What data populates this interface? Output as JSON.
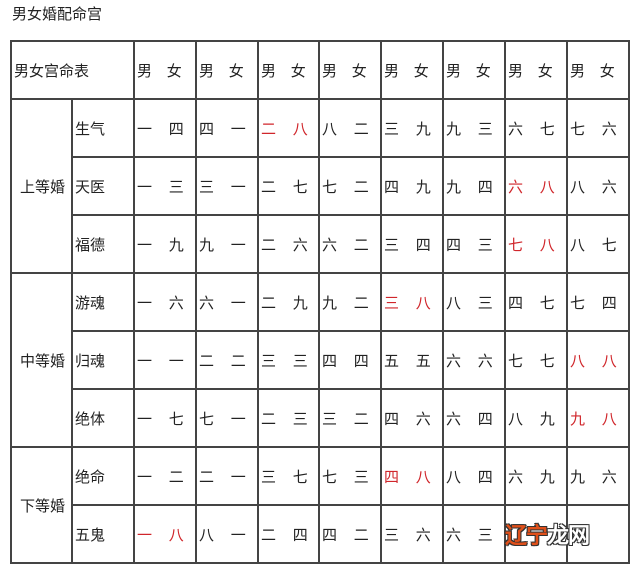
{
  "page": {
    "title": "男女婚配命宫"
  },
  "table": {
    "corner_label": "男女宫命表",
    "column_headers": [
      "男 女",
      "男 女",
      "男 女",
      "男 女",
      "男 女",
      "男 女",
      "男 女",
      "男 女"
    ],
    "highlight_color": "#d0262b",
    "groups": [
      {
        "label": "上等婚",
        "rows": [
          {
            "name": "生气",
            "cells": [
              {
                "text": "一 四",
                "red": false
              },
              {
                "text": "四 一",
                "red": false
              },
              {
                "text": "二 八",
                "red": true
              },
              {
                "text": "八 二",
                "red": false
              },
              {
                "text": "三 九",
                "red": false
              },
              {
                "text": "九 三",
                "red": false
              },
              {
                "text": "六 七",
                "red": false
              },
              {
                "text": "七 六",
                "red": false
              }
            ]
          },
          {
            "name": "天医",
            "cells": [
              {
                "text": "一 三",
                "red": false
              },
              {
                "text": "三 一",
                "red": false
              },
              {
                "text": "二 七",
                "red": false
              },
              {
                "text": "七 二",
                "red": false
              },
              {
                "text": "四 九",
                "red": false
              },
              {
                "text": "九 四",
                "red": false
              },
              {
                "text": "六 八",
                "red": true
              },
              {
                "text": "八 六",
                "red": false
              }
            ]
          },
          {
            "name": "福德",
            "cells": [
              {
                "text": "一 九",
                "red": false
              },
              {
                "text": "九 一",
                "red": false
              },
              {
                "text": "二 六",
                "red": false
              },
              {
                "text": "六 二",
                "red": false
              },
              {
                "text": "三 四",
                "red": false
              },
              {
                "text": "四 三",
                "red": false
              },
              {
                "text": "七 八",
                "red": true
              },
              {
                "text": "八 七",
                "red": false
              }
            ]
          }
        ]
      },
      {
        "label": "中等婚",
        "rows": [
          {
            "name": "游魂",
            "cells": [
              {
                "text": "一 六",
                "red": false
              },
              {
                "text": "六 一",
                "red": false
              },
              {
                "text": "二 九",
                "red": false
              },
              {
                "text": "九 二",
                "red": false
              },
              {
                "text": "三 八",
                "red": true
              },
              {
                "text": "八 三",
                "red": false
              },
              {
                "text": "四 七",
                "red": false
              },
              {
                "text": "七 四",
                "red": false
              }
            ]
          },
          {
            "name": "归魂",
            "cells": [
              {
                "text": "一 一",
                "red": false
              },
              {
                "text": "二 二",
                "red": false
              },
              {
                "text": "三 三",
                "red": false
              },
              {
                "text": "四 四",
                "red": false
              },
              {
                "text": "五 五",
                "red": false
              },
              {
                "text": "六 六",
                "red": false
              },
              {
                "text": "七 七",
                "red": false
              },
              {
                "text": "八 八",
                "red": true
              }
            ]
          },
          {
            "name": "绝体",
            "cells": [
              {
                "text": "一 七",
                "red": false
              },
              {
                "text": "七 一",
                "red": false
              },
              {
                "text": "二 三",
                "red": false
              },
              {
                "text": "三 二",
                "red": false
              },
              {
                "text": "四 六",
                "red": false
              },
              {
                "text": "六 四",
                "red": false
              },
              {
                "text": "八 九",
                "red": false
              },
              {
                "text": "九 八",
                "red": true
              }
            ]
          }
        ]
      },
      {
        "label": "下等婚",
        "rows": [
          {
            "name": "绝命",
            "cells": [
              {
                "text": "一 二",
                "red": false
              },
              {
                "text": "二 一",
                "red": false
              },
              {
                "text": "三 七",
                "red": false
              },
              {
                "text": "七 三",
                "red": false
              },
              {
                "text": "四 八",
                "red": true
              },
              {
                "text": "八 四",
                "red": false
              },
              {
                "text": "六 九",
                "red": false
              },
              {
                "text": "九 六",
                "red": false
              }
            ]
          },
          {
            "name": "五鬼",
            "cells": [
              {
                "text": "一 八",
                "red": true
              },
              {
                "text": "八 一",
                "red": false
              },
              {
                "text": "二 四",
                "red": false
              },
              {
                "text": "四 二",
                "red": false
              },
              {
                "text": "三 六",
                "red": false
              },
              {
                "text": "六 三",
                "red": false
              },
              {
                "text": "",
                "red": false
              },
              {
                "text": ""
              }
            ]
          }
        ]
      }
    ]
  },
  "watermark": {
    "part1": "辽宁",
    "part2": "龙网"
  }
}
